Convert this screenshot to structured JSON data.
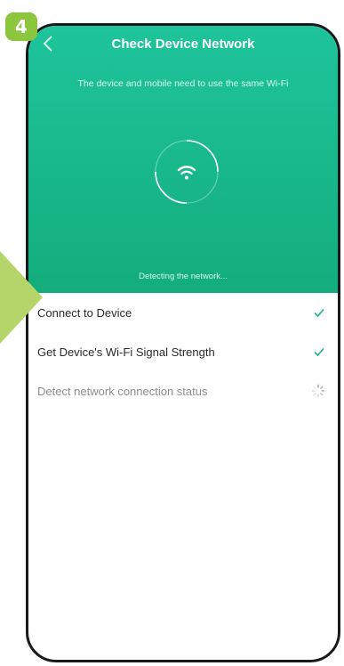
{
  "step_badge": "4",
  "header": {
    "title": "Check Device Network",
    "subtitle": "The device and mobile need to use the same Wi-Fi",
    "status": "Detecting the network..."
  },
  "steps": [
    {
      "label": "Connect to Device",
      "state": "done"
    },
    {
      "label": "Get Device's Wi-Fi Signal Strength",
      "state": "done"
    },
    {
      "label": "Detect network connection status",
      "state": "loading"
    }
  ],
  "colors": {
    "header_green": "#1fc49b",
    "check_green": "#20b784",
    "badge_green": "#8cc63f",
    "pointer_green": "#b5d46a"
  },
  "icons": {
    "back": "chevron-left-icon",
    "wifi": "wifi-icon",
    "done": "checkmark-icon",
    "loading": "loading-spinner-icon"
  }
}
